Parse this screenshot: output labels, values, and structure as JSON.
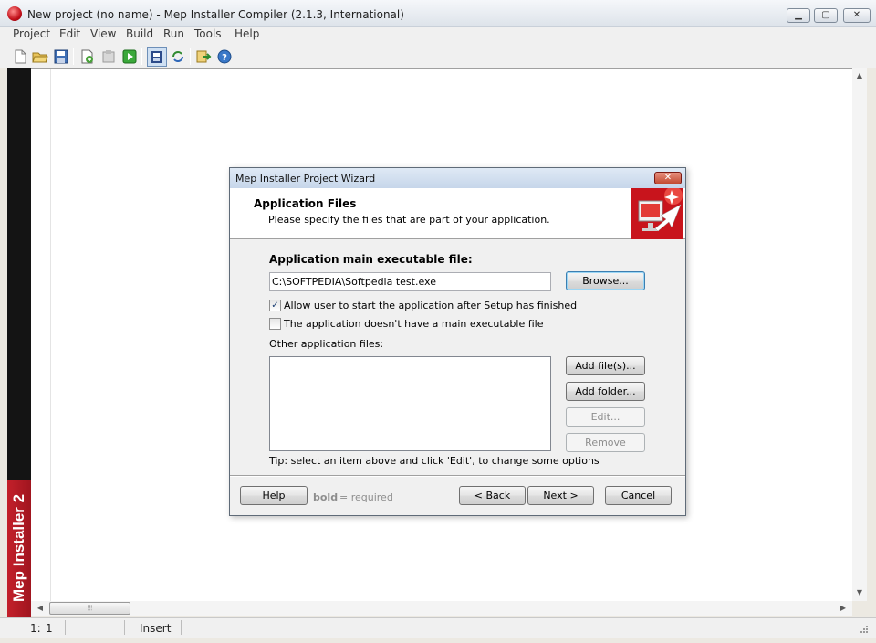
{
  "window": {
    "title": "New project (no name) - Mep Installer Compiler (2.1.3, International)",
    "minimize_glyph": "▁",
    "maximize_glyph": "▢",
    "close_glyph": "✕"
  },
  "menu": [
    "Project",
    "Edit",
    "View",
    "Build",
    "Run",
    "Tools",
    "Help"
  ],
  "toolbar": {
    "icons": [
      "new-file-icon",
      "open-folder-icon",
      "save-icon",
      "add-files-icon",
      "properties-icon",
      "run-icon",
      "compile-icon",
      "refresh-icon",
      "export-icon",
      "help-icon"
    ]
  },
  "banner": {
    "text": "Mep Installer 2"
  },
  "scrollbar": {
    "up": "▲",
    "down": "▼",
    "left": "◀",
    "right": "▶",
    "grip": "⦙⦙⦙"
  },
  "status": {
    "line": "1:",
    "col": "1",
    "mode": "Insert"
  },
  "dialog": {
    "title": "Mep Installer Project Wizard",
    "close_glyph": "✕",
    "header_title": "Application Files",
    "header_subtitle": "Please specify the files that are part of your application.",
    "main_exe_label": "Application main executable file:",
    "main_exe_value": "C:\\SOFTPEDIA\\Softpedia test.exe",
    "browse_label": "Browse...",
    "allow_start_label": "Allow user to start the application after Setup has finished",
    "allow_start_checked": true,
    "no_main_exe_label": "The application doesn't have a main executable file",
    "no_main_exe_checked": false,
    "other_files_label": "Other application files:",
    "add_files_label": "Add file(s)...",
    "add_folder_label": "Add folder...",
    "edit_label": "Edit...",
    "remove_label": "Remove",
    "tip": "Tip: select an item above and click 'Edit', to change some options",
    "help_label": "Help",
    "hint_bold": "bold",
    "hint_rest": "= required",
    "back_label": "< Back",
    "next_label": "Next >",
    "cancel_label": "Cancel",
    "check_glyph": "✓"
  }
}
